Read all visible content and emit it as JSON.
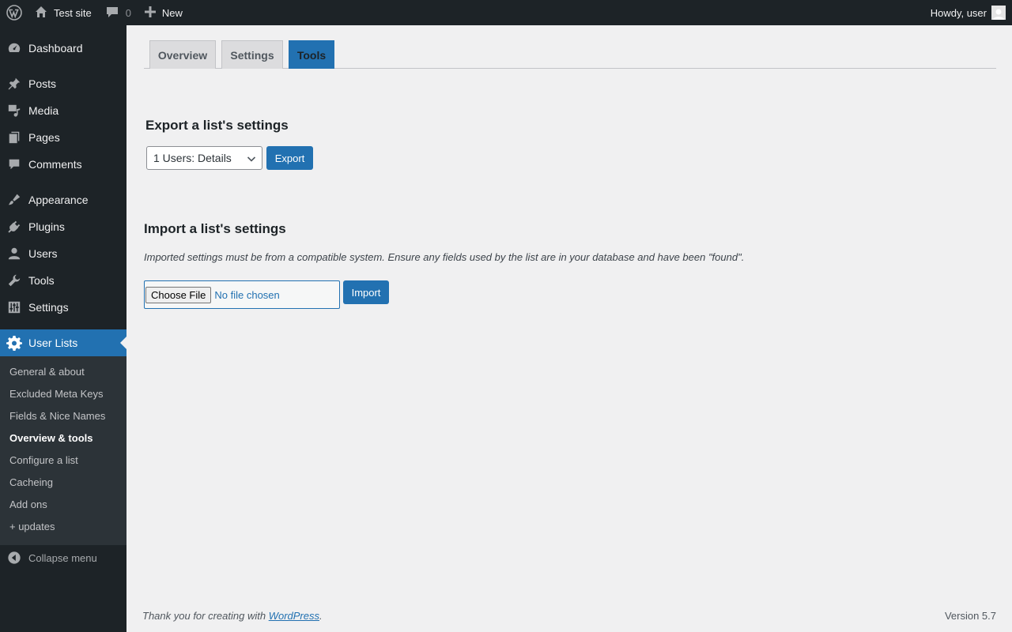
{
  "admin_bar": {
    "site_name": "Test site",
    "comments_count": "0",
    "new_label": "New",
    "howdy": "Howdy, user"
  },
  "sidebar": {
    "items": [
      {
        "label": "Dashboard",
        "icon": "dashboard-icon"
      },
      {
        "label": "Posts",
        "icon": "pin-icon"
      },
      {
        "label": "Media",
        "icon": "media-icon"
      },
      {
        "label": "Pages",
        "icon": "pages-icon"
      },
      {
        "label": "Comments",
        "icon": "comment-icon"
      },
      {
        "label": "Appearance",
        "icon": "brush-icon"
      },
      {
        "label": "Plugins",
        "icon": "plug-icon"
      },
      {
        "label": "Users",
        "icon": "user-icon"
      },
      {
        "label": "Tools",
        "icon": "wrench-icon"
      },
      {
        "label": "Settings",
        "icon": "sliders-icon"
      },
      {
        "label": "User Lists",
        "icon": "gear-icon"
      }
    ],
    "submenu": [
      "General & about",
      "Excluded Meta Keys",
      "Fields & Nice Names",
      "Overview & tools",
      "Configure a list",
      "Cacheing",
      "Add ons",
      "+ updates"
    ],
    "collapse_label": "Collapse menu"
  },
  "tabs": [
    "Overview",
    "Settings",
    "Tools"
  ],
  "export": {
    "heading": "Export a list's settings",
    "selected_list": "1 Users: Details",
    "button": "Export"
  },
  "import": {
    "heading": "Import a list's settings",
    "description": "Imported settings must be from a compatible system. Ensure any fields used by the list are in your database and have been \"found\".",
    "choose_file": "Choose File",
    "file_status": "No file chosen",
    "button": "Import"
  },
  "footer": {
    "thanks_prefix": "Thank you for creating with ",
    "wordpress_link": "WordPress",
    "thanks_suffix": ".",
    "version": "Version 5.7"
  },
  "colors": {
    "admin_bar": "#1d2327",
    "accent": "#2271b1",
    "submenu_bg": "#2c3338",
    "page_bg": "#f0f0f1"
  }
}
